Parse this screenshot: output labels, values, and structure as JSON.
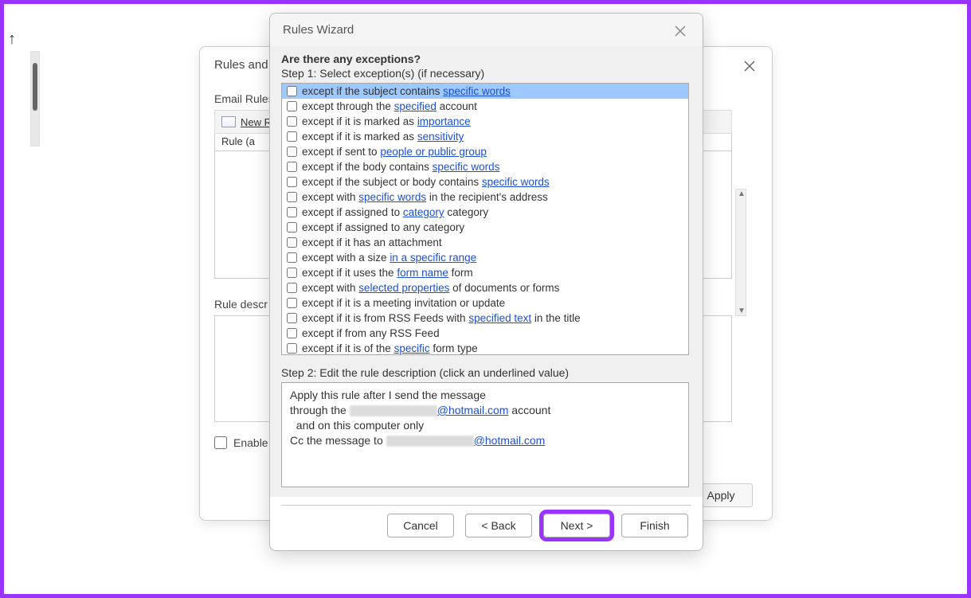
{
  "rules_alerts": {
    "title": "Rules and A",
    "tab_label": "Email Rules",
    "new_rule": "New R",
    "list_header": "Rule (a",
    "desc_label": "Rule descr",
    "enable_label": "Enable",
    "apply": "Apply"
  },
  "wizard": {
    "title": "Rules Wizard",
    "question": "Are there any exceptions?",
    "step1": "Step 1: Select exception(s) (if necessary)",
    "step2": "Step 2: Edit the rule description (click an underlined value)",
    "items": [
      {
        "pre": "except if the subject contains ",
        "link": "specific words",
        "post": "",
        "selected": true
      },
      {
        "pre": "except through the ",
        "link": "specified",
        "post": " account"
      },
      {
        "pre": "except if it is marked as ",
        "link": "importance",
        "post": ""
      },
      {
        "pre": "except if it is marked as ",
        "link": "sensitivity",
        "post": ""
      },
      {
        "pre": "except if sent to ",
        "link": "people or public group",
        "post": ""
      },
      {
        "pre": "except if the body contains ",
        "link": "specific words",
        "post": ""
      },
      {
        "pre": "except if the subject or body contains ",
        "link": "specific words",
        "post": ""
      },
      {
        "pre": "except with ",
        "link": "specific words",
        "post": " in the recipient's address"
      },
      {
        "pre": "except if assigned to ",
        "link": "category",
        "post": " category"
      },
      {
        "pre": "except if assigned to any category",
        "link": "",
        "post": ""
      },
      {
        "pre": "except if it has an attachment",
        "link": "",
        "post": ""
      },
      {
        "pre": "except with a size ",
        "link": "in a specific range",
        "post": ""
      },
      {
        "pre": "except if it uses the ",
        "link": "form name",
        "post": " form"
      },
      {
        "pre": "except with ",
        "link": "selected properties",
        "post": " of documents or forms"
      },
      {
        "pre": "except if it is a meeting invitation or update",
        "link": "",
        "post": ""
      },
      {
        "pre": "except if it is from RSS Feeds with ",
        "link": "specified text",
        "post": " in the title"
      },
      {
        "pre": "except if from any RSS Feed",
        "link": "",
        "post": ""
      },
      {
        "pre": "except if it is of the ",
        "link": "specific",
        "post": " form type"
      }
    ],
    "desc": {
      "line1": "Apply this rule after I send the message",
      "line2a": "through the ",
      "line2b": "@hotmail.com",
      "line2c": " account",
      "line3": "  and on this computer only",
      "line4a": "Cc the message to ",
      "line4b": "@hotmail.com"
    },
    "buttons": {
      "cancel": "Cancel",
      "back": "< Back",
      "next": "Next >",
      "finish": "Finish"
    }
  }
}
